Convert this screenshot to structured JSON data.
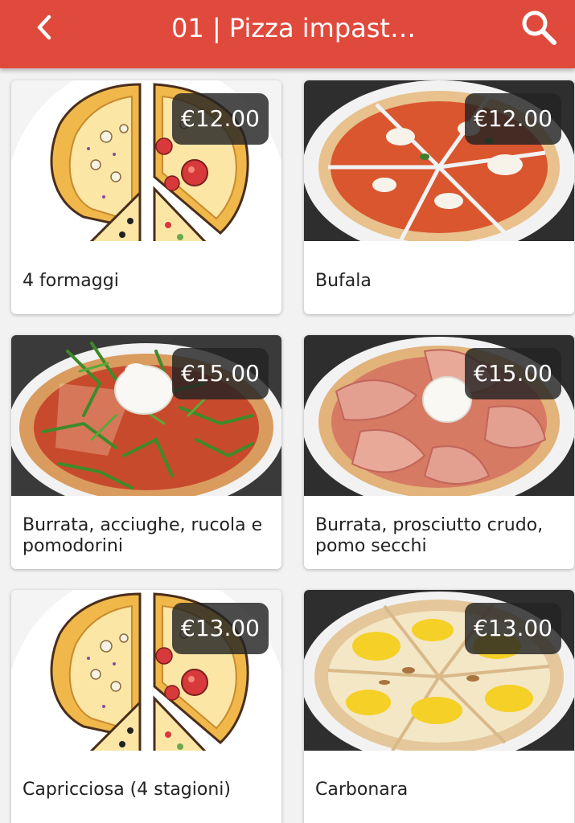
{
  "header": {
    "title": "01 | Pizza impast…",
    "back_icon": "chevron-left-icon",
    "search_icon": "search-icon",
    "color": "#e04a3c"
  },
  "products": [
    {
      "name": "4 formaggi",
      "price": "€12.00",
      "image": "cartoon-pizza-illustration"
    },
    {
      "name": "Bufala",
      "price": "€12.00",
      "image": "margherita-bufala-photo"
    },
    {
      "name": "Burrata, acciughe, rucola e pomodorini",
      "price": "€15.00",
      "image": "burrata-rucola-photo"
    },
    {
      "name": "Burrata, prosciutto crudo, pomo secchi",
      "price": "€15.00",
      "image": "burrata-prosciutto-photo"
    },
    {
      "name": "Capricciosa (4 stagioni)",
      "price": "€13.00",
      "image": "cartoon-pizza-illustration"
    },
    {
      "name": "Carbonara",
      "price": "€13.00",
      "image": "carbonara-photo"
    }
  ]
}
